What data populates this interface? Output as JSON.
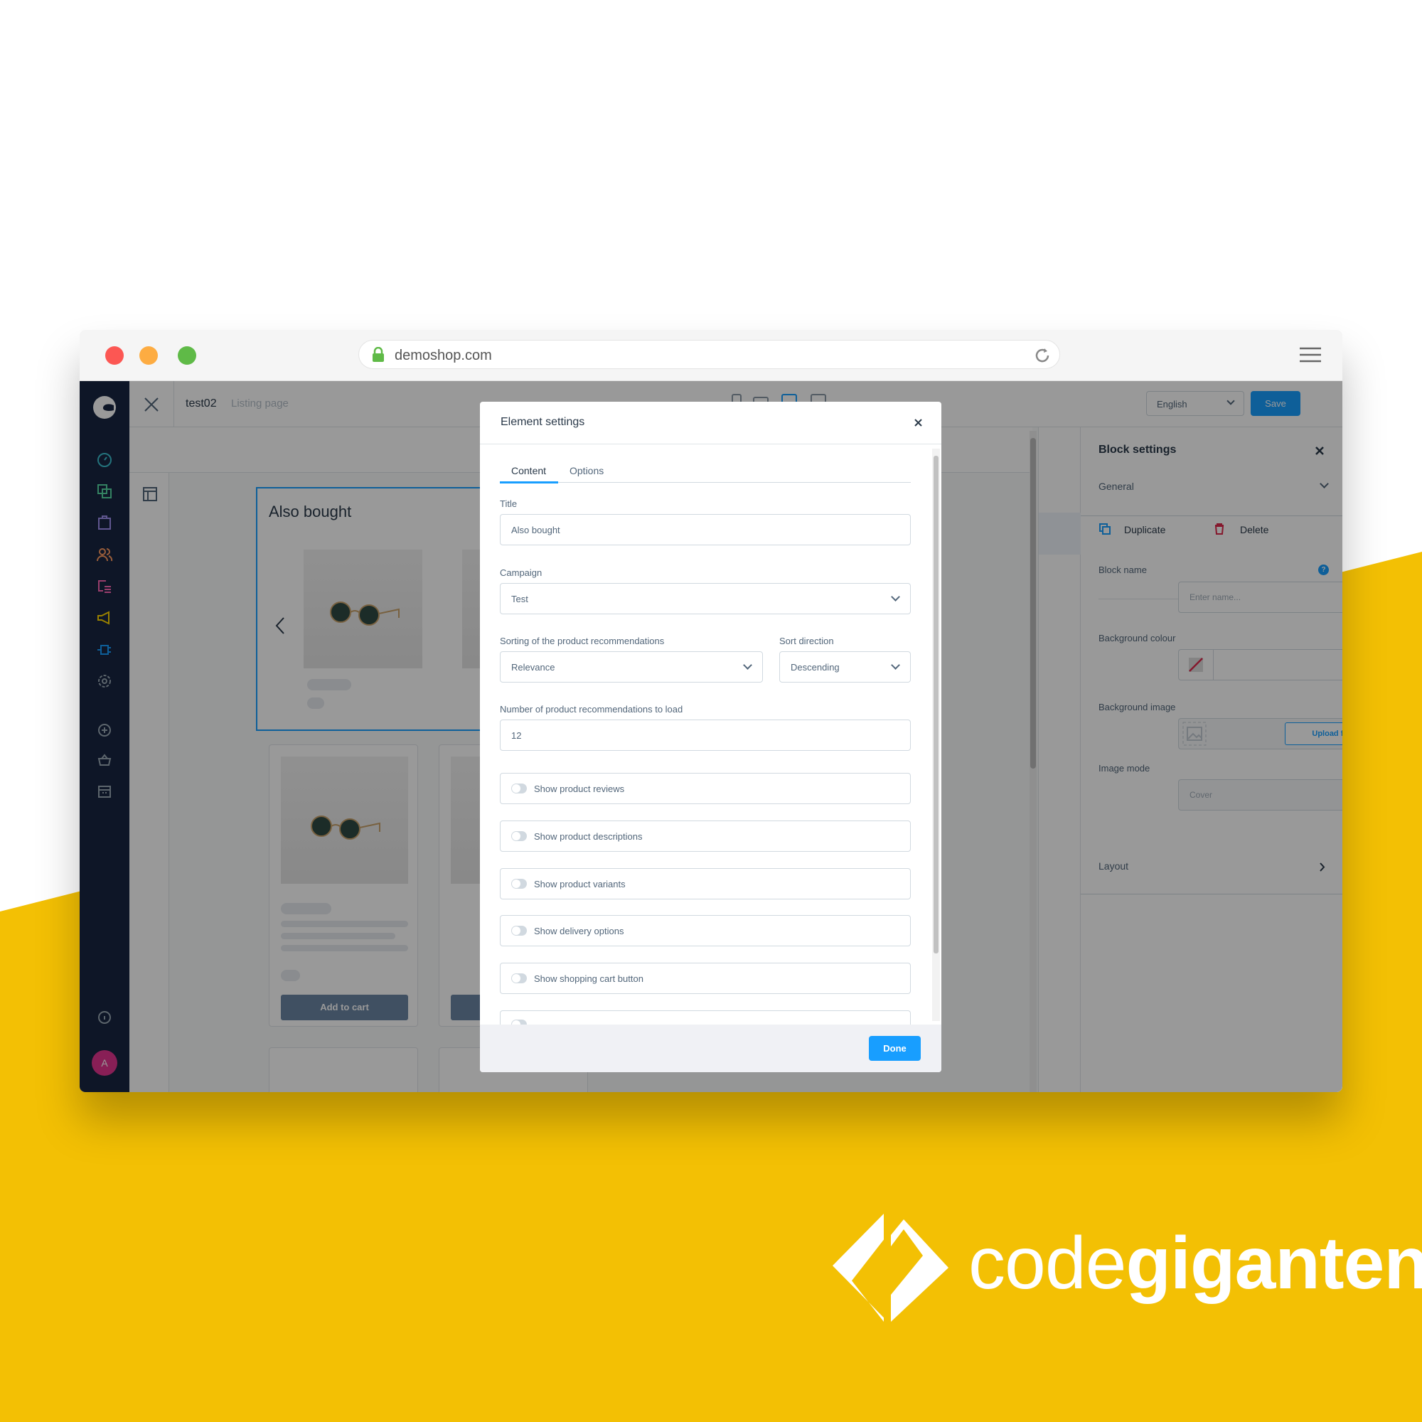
{
  "browser": {
    "url": "demoshop.com"
  },
  "colors": {
    "yellow": "#f3c004",
    "accent": "#189eff",
    "sidebar": "#182642"
  },
  "header": {
    "page_name": "test02",
    "page_type": "Listing page",
    "language": "English",
    "save_label": "Save"
  },
  "sidebar": {
    "items": [
      "dashboard-icon",
      "catalogues-icon",
      "orders-icon",
      "customers-icon",
      "content-icon",
      "marketing-icon",
      "extensions-icon",
      "settings-icon",
      "add-icon",
      "sales-channel-icon",
      "store-icon",
      "help-icon"
    ],
    "avatar": "A"
  },
  "canvas": {
    "block_title": "Also bought",
    "add_to_cart": "Add to cart"
  },
  "modal": {
    "title": "Element settings",
    "tabs": [
      "Content",
      "Options"
    ],
    "title_label": "Title",
    "title_value": "Also bought",
    "campaign_label": "Campaign",
    "campaign_value": "Test",
    "sorting_label": "Sorting of the product recommendations",
    "sorting_value": "Relevance",
    "direction_label": "Sort direction",
    "direction_value": "Descending",
    "number_label": "Number of product recommendations to load",
    "number_value": "12",
    "toggles": [
      "Show product reviews",
      "Show product descriptions",
      "Show product variants",
      "Show delivery options",
      "Show shopping cart button"
    ],
    "done_label": "Done"
  },
  "block_settings": {
    "title": "Block settings",
    "general": "General",
    "duplicate": "Duplicate",
    "delete": "Delete",
    "block_name_label": "Block name",
    "block_name_placeholder": "Enter name...",
    "bg_colour_label": "Background colour",
    "bg_image_label": "Background image",
    "upload_label": "Upload file",
    "image_mode_label": "Image mode",
    "image_mode_value": "Cover",
    "layout": "Layout"
  },
  "brand": {
    "light": "code",
    "bold": "giganten"
  }
}
